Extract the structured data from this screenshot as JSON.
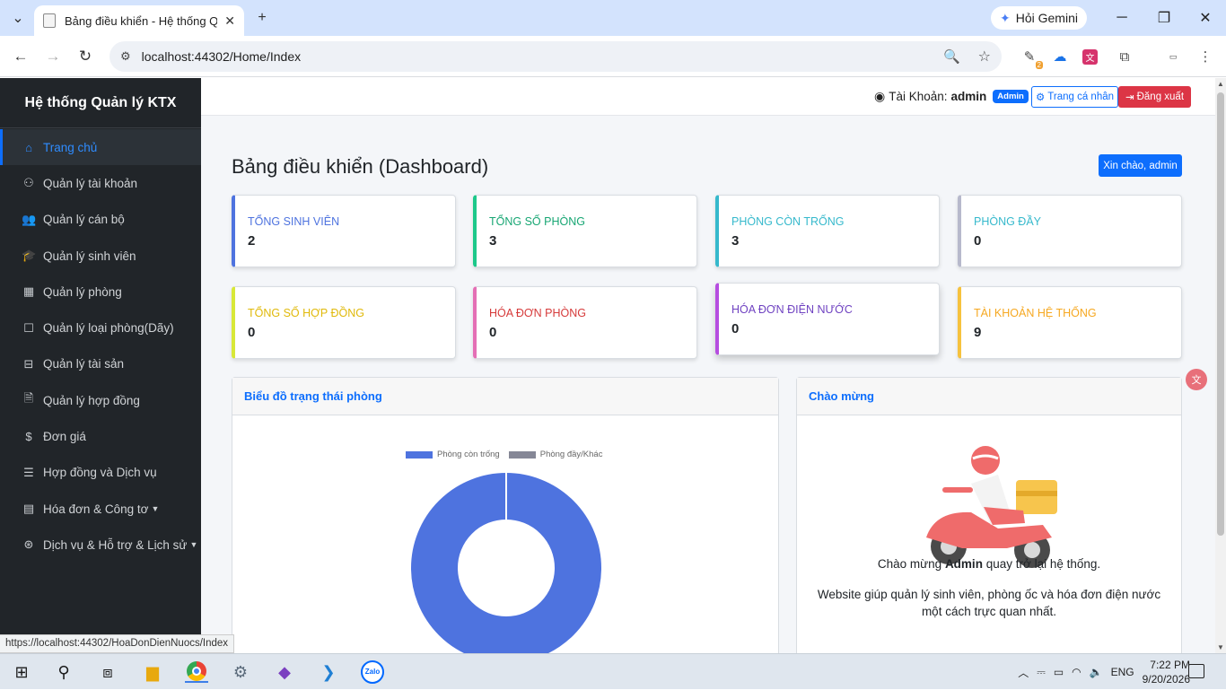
{
  "browser": {
    "tab_title": "Bảng điều khiển - Hệ thống Qu",
    "gemini_label": "Hỏi Gemini",
    "url": "localhost:44302/Home/Index",
    "status_url": "https://localhost:44302/HoaDonDienNuocs/Index",
    "ext_badge": "2"
  },
  "sidebar": {
    "brand": "Hệ thống Quản lý KTX",
    "items": [
      {
        "label": "Trang chủ",
        "icon": "⌂"
      },
      {
        "label": "Quản lý tài khoản",
        "icon": "⚇"
      },
      {
        "label": "Quản lý cán bộ",
        "icon": "👥"
      },
      {
        "label": "Quản lý sinh viên",
        "icon": "🎓"
      },
      {
        "label": "Quản lý phòng",
        "icon": "▦"
      },
      {
        "label": "Quản lý loại phòng(Dãy)",
        "icon": "☐"
      },
      {
        "label": "Quản lý tài sản",
        "icon": "⊟"
      },
      {
        "label": "Quản lý hợp đồng",
        "icon": "🗎"
      },
      {
        "label": "Đơn giá",
        "icon": "$"
      },
      {
        "label": "Hợp đồng và Dịch vụ",
        "icon": "☰"
      },
      {
        "label": "Hóa đơn & Công tơ",
        "icon": "▤"
      },
      {
        "label": "Dịch vụ & Hỗ trợ & Lịch sử",
        "icon": "⊛"
      }
    ]
  },
  "topnav": {
    "account_prefix": "Tài Khoản:",
    "account_name": "admin",
    "role_badge": "Admin",
    "profile_label": "Trang cá nhân",
    "logout_label": "Đăng xuất"
  },
  "dashboard": {
    "title": "Bảng điều khiển (Dashboard)",
    "greeting": "Xin chào, admin",
    "stats": [
      {
        "label": "TỔNG SINH VIÊN",
        "value": "2",
        "color": "#4e73df"
      },
      {
        "label": "TỔNG SỐ PHÒNG",
        "value": "3",
        "color": "#1cc88a"
      },
      {
        "label": "PHÒNG CÒN TRỐNG",
        "value": "3",
        "color": "#36b9cc"
      },
      {
        "label": "PHÒNG ĐẦY",
        "value": "0",
        "color": "#858796"
      },
      {
        "label": "TỔNG SỐ HỢP ĐỒNG",
        "value": "0",
        "color": "#f6c23e"
      },
      {
        "label": "HÓA ĐƠN PHÒNG",
        "value": "0",
        "color": "#e74a3b"
      },
      {
        "label": "HÓA ĐƠN ĐIỆN NƯỚC",
        "value": "0",
        "color": "#6f42c1"
      },
      {
        "label": "TÀI KHOẢN HỆ THỐNG",
        "value": "9",
        "color": "#fd7e14"
      }
    ],
    "chart_card_title": "Biểu đồ trạng thái phòng",
    "welcome_card_title": "Chào mừng",
    "welcome_prefix": "Chào mừng",
    "welcome_name": "Admin",
    "welcome_suffix": "quay trở lại hệ thống.",
    "description": "Website giúp quản lý sinh viên, phòng ốc và hóa đơn điện nước một cách trực quan nhất."
  },
  "chart_data": {
    "type": "pie",
    "categories": [
      "Phòng còn trống",
      "Phòng đầy/Khác"
    ],
    "values": [
      3,
      0
    ],
    "colors": [
      "#4e73df",
      "#858796"
    ],
    "legend": "top"
  },
  "taskbar": {
    "lang": "ENG",
    "time": "7:22 PM",
    "date": "9/20/2026",
    "zalo": "Zalo"
  },
  "colors": {
    "primary": "#0d6efd",
    "danger": "#dc3545",
    "sidebar_bg": "#212529"
  }
}
